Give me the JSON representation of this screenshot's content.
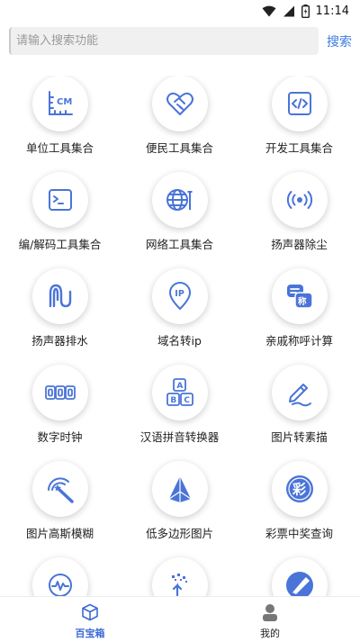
{
  "status_bar": {
    "time": "11:14",
    "icons": [
      "wifi-icon",
      "signal-icon",
      "battery-icon"
    ]
  },
  "search": {
    "placeholder": "请输入搜索功能",
    "button_label": "搜索"
  },
  "tools": [
    {
      "label": "单位工具集合",
      "icon": "ruler-cm-icon"
    },
    {
      "label": "便民工具集合",
      "icon": "heart-handshake-icon"
    },
    {
      "label": "开发工具集合",
      "icon": "code-icon"
    },
    {
      "label": "编/解码工具集合",
      "icon": "terminal-icon"
    },
    {
      "label": "网络工具集合",
      "icon": "globe-tools-icon"
    },
    {
      "label": "扬声器除尘",
      "icon": "speaker-signal-icon"
    },
    {
      "label": "扬声器排水",
      "icon": "wave-icon"
    },
    {
      "label": "域名转ip",
      "icon": "ip-pin-icon"
    },
    {
      "label": "亲戚称呼计算",
      "icon": "chat-badge-icon"
    },
    {
      "label": "数字时钟",
      "icon": "digital-clock-icon"
    },
    {
      "label": "汉语拼音转换器",
      "icon": "abc-blocks-icon"
    },
    {
      "label": "图片转素描",
      "icon": "pen-sketch-icon"
    },
    {
      "label": "图片高斯模糊",
      "icon": "magic-wand-icon"
    },
    {
      "label": "低多边形图片",
      "icon": "polygon-icon"
    },
    {
      "label": "彩票中奖查询",
      "icon": "lottery-icon"
    },
    {
      "label": "",
      "icon": "pulse-chart-icon"
    },
    {
      "label": "",
      "icon": "pixel-upload-icon"
    },
    {
      "label": "",
      "icon": "brush-icon"
    }
  ],
  "bottom_nav": [
    {
      "label": "百宝箱",
      "icon": "box-icon",
      "active": true
    },
    {
      "label": "我的",
      "icon": "user-icon",
      "active": false
    }
  ],
  "colors": {
    "accent": "#3c7be0",
    "icon_blue": "#4a74d8",
    "nav_active": "#3c6bd6"
  }
}
